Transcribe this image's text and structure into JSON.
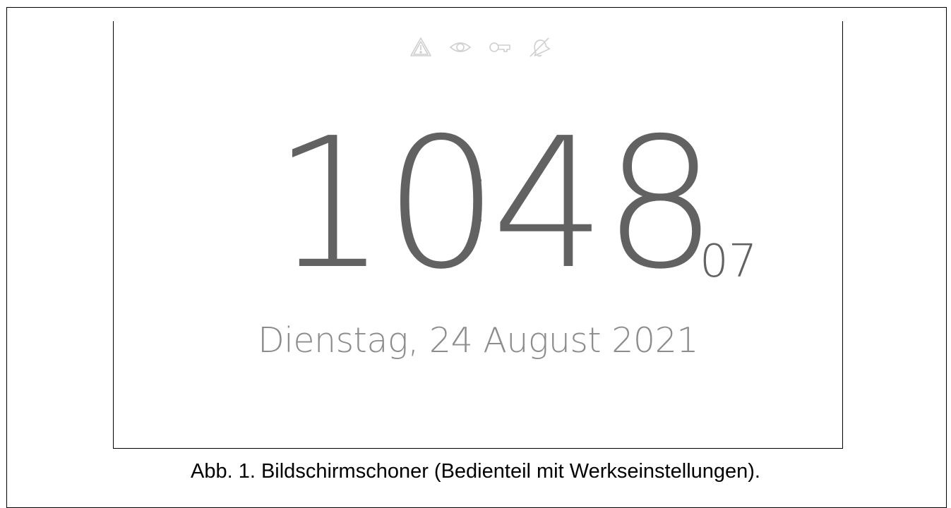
{
  "screen": {
    "status_icons": [
      "warning-icon",
      "eye-icon",
      "key-icon",
      "bell-off-icon"
    ],
    "status_icon_color": "#cfcfcf",
    "time": {
      "hours": "10",
      "minutes": "48",
      "seconds": "07"
    },
    "date": "Dienstag, 24 August 2021",
    "text_color": "#626262",
    "date_color": "#8c8c8c"
  },
  "caption": "Abb. 1. Bildschirmschoner (Bedienteil mit Werkseinstellungen)."
}
